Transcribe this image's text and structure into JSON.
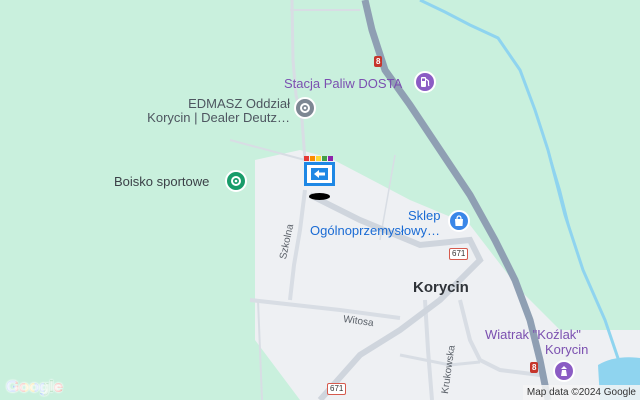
{
  "map": {
    "pois": {
      "gas_station": "Stacja Paliw DOSTA",
      "dealer_line1": "EDMASZ Oddział",
      "dealer_line2": "Korycin | Dealer Deutz…",
      "pitch": "Boisko sportowe",
      "shop_line1": "Sklep",
      "shop_line2": "Ogólnoprzemysłowy…",
      "windmill_line1": "Wiatrak \"Koźlak\"",
      "windmill_line2": "Korycin"
    },
    "town": "Korycin",
    "streets": {
      "szkolna": "Szkolna",
      "witosa": "Witosa",
      "krukowska": "Krukowska"
    },
    "road_shields": {
      "route_8_top": "8",
      "route_8_bottom": "8",
      "route_671_right": "671",
      "route_671_bottom": "671"
    },
    "colors": {
      "background": "#c9f0dd",
      "town_area": "#eef0f3",
      "highway": "#8f9fb3",
      "river": "#8fd4ef"
    }
  },
  "footer": {
    "logo": "Google",
    "attribution": "Map data ©2024 Google"
  }
}
